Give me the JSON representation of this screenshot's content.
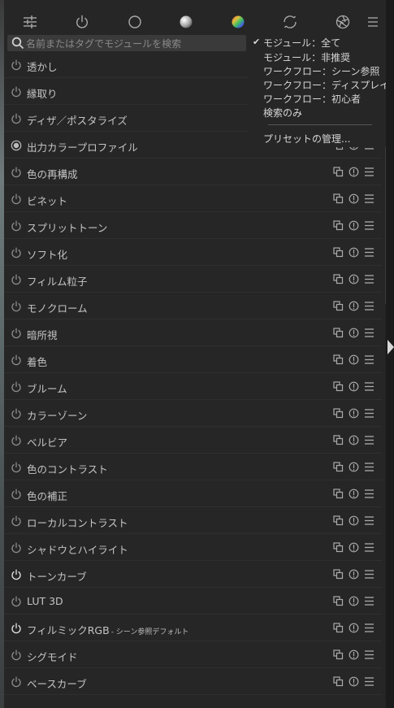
{
  "toolbar": {
    "icons": [
      {
        "name": "sliders-icon"
      },
      {
        "name": "power-icon"
      },
      {
        "name": "circle-icon"
      },
      {
        "name": "sphere-icon"
      },
      {
        "name": "color-wheel-icon"
      },
      {
        "name": "refresh-circle-icon"
      },
      {
        "name": "aperture-icon"
      },
      {
        "name": "hamburger-menu-icon"
      }
    ]
  },
  "search": {
    "placeholder": "名前またはタグでモジュールを検索"
  },
  "dropdown": {
    "items": [
      {
        "label": "モジュール：全て",
        "checked": true
      },
      {
        "label": "モジュール：非推奨",
        "checked": false
      },
      {
        "label": "ワークフロー：シーン参照",
        "checked": false
      },
      {
        "label": "ワークフロー：ディスプレイ参照",
        "checked": false
      },
      {
        "label": "ワークフロー：初心者",
        "checked": false
      },
      {
        "label": "検索のみ",
        "checked": false
      }
    ],
    "manage_label": "プリセットの管理..."
  },
  "modules": [
    {
      "label": "透かし",
      "sub": "",
      "enabled": false,
      "radio": false
    },
    {
      "label": "縁取り",
      "sub": "",
      "enabled": false,
      "radio": false
    },
    {
      "label": "ディザ／ポスタライズ",
      "sub": "",
      "enabled": false,
      "radio": false
    },
    {
      "label": "出力カラープロファイル",
      "sub": "",
      "enabled": true,
      "radio": true
    },
    {
      "label": "色の再構成",
      "sub": "",
      "enabled": false,
      "radio": false
    },
    {
      "label": "ビネット",
      "sub": "",
      "enabled": false,
      "radio": false
    },
    {
      "label": "スプリットトーン",
      "sub": "",
      "enabled": false,
      "radio": false
    },
    {
      "label": "ソフト化",
      "sub": "",
      "enabled": false,
      "radio": false
    },
    {
      "label": "フィルム粒子",
      "sub": "",
      "enabled": false,
      "radio": false
    },
    {
      "label": "モノクローム",
      "sub": "",
      "enabled": false,
      "radio": false
    },
    {
      "label": "暗所視",
      "sub": "",
      "enabled": false,
      "radio": false
    },
    {
      "label": "着色",
      "sub": "",
      "enabled": false,
      "radio": false
    },
    {
      "label": "ブルーム",
      "sub": "",
      "enabled": false,
      "radio": false
    },
    {
      "label": "カラーゾーン",
      "sub": "",
      "enabled": false,
      "radio": false
    },
    {
      "label": "ベルビア",
      "sub": "",
      "enabled": false,
      "radio": false
    },
    {
      "label": "色のコントラスト",
      "sub": "",
      "enabled": false,
      "radio": false
    },
    {
      "label": "色の補正",
      "sub": "",
      "enabled": false,
      "radio": false
    },
    {
      "label": "ローカルコントラスト",
      "sub": "",
      "enabled": false,
      "radio": false
    },
    {
      "label": "シャドウとハイライト",
      "sub": "",
      "enabled": false,
      "radio": false
    },
    {
      "label": "トーンカーブ",
      "sub": "",
      "enabled": true,
      "radio": false
    },
    {
      "label": "LUT 3D",
      "sub": "",
      "enabled": false,
      "radio": false
    },
    {
      "label": "フィルミックRGB",
      "sub": "- シーン参照デフォルト",
      "enabled": true,
      "radio": false
    },
    {
      "label": "シグモイド",
      "sub": "",
      "enabled": false,
      "radio": false
    },
    {
      "label": "ベースカーブ",
      "sub": "",
      "enabled": false,
      "radio": false
    }
  ],
  "row_actions": [
    "instances-icon",
    "reset-icon",
    "presets-icon"
  ]
}
